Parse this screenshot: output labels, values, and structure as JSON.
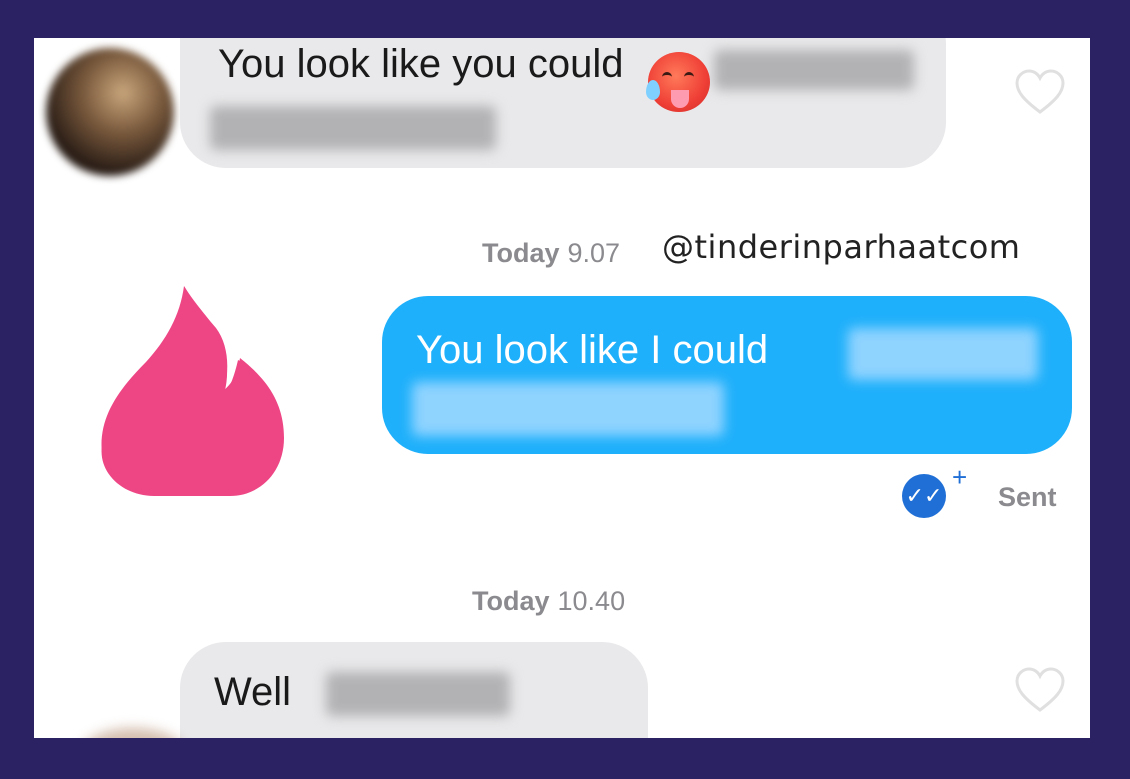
{
  "messages": {
    "incoming_1": {
      "text": "You look like you could",
      "emoji": "hot-face-emoji"
    },
    "outgoing_1": {
      "text": "You look like I could"
    },
    "incoming_2": {
      "text": "Well"
    }
  },
  "timestamps": {
    "t1": {
      "day": "Today",
      "time": "9.07"
    },
    "t2": {
      "day": "Today",
      "time": "10.40"
    }
  },
  "watermark": "@tinderinparhaatcom",
  "status": {
    "label": "Sent",
    "check_glyph": "✓✓",
    "plus_glyph": "+"
  },
  "colors": {
    "page_bg": "#2a2263",
    "incoming_bubble": "#e9e9eb",
    "outgoing_bubble": "#1fb0fb",
    "logo": "#ee4685",
    "status_check": "#1f6fd6"
  },
  "icons": [
    "heart-icon",
    "tinder-flame-logo",
    "double-check-icon"
  ]
}
